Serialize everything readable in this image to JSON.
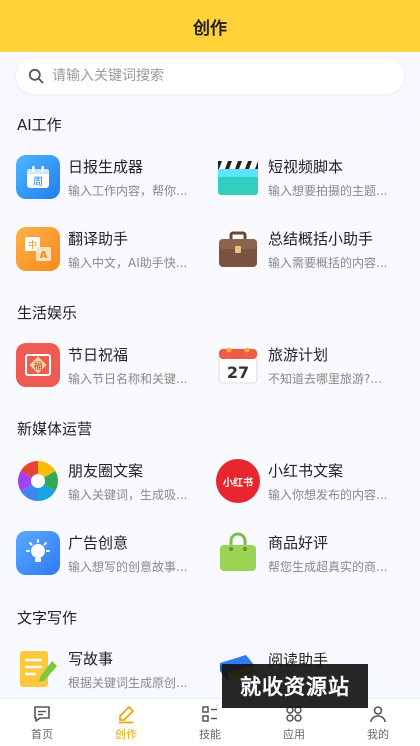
{
  "header": {
    "title": "创作"
  },
  "search": {
    "placeholder": "请输入关键词搜索"
  },
  "sections": {
    "ai_work": {
      "title": "AI工作",
      "items": [
        {
          "name": "日报生成器",
          "desc": "输入工作内容，帮你...",
          "icon": "calendar-icon"
        },
        {
          "name": "短视频脚本",
          "desc": "输入想要拍摄的主题...",
          "icon": "clapperboard-icon"
        },
        {
          "name": "翻译助手",
          "desc": "输入中文，AI助手快...",
          "icon": "translate-icon"
        },
        {
          "name": "总结概括小助手",
          "desc": "输入需要概括的内容...",
          "icon": "briefcase-icon"
        }
      ]
    },
    "life": {
      "title": "生活娱乐",
      "items": [
        {
          "name": "节日祝福",
          "desc": "输入节日名称和关键...",
          "icon": "blessing-icon"
        },
        {
          "name": "旅游计划",
          "desc": "不知道去哪里旅游?...",
          "icon": "calendar-27-icon",
          "day": "27"
        }
      ]
    },
    "new_media": {
      "title": "新媒体运营",
      "items": [
        {
          "name": "朋友圈文案",
          "desc": "输入关键词，生成吸...",
          "icon": "aperture-icon"
        },
        {
          "name": "小红书文案",
          "desc": "输入你想发布的内容...",
          "icon": "xiaohongshu-icon",
          "badge": "小红书"
        },
        {
          "name": "广告创意",
          "desc": "输入想写的创意故事...",
          "icon": "lightbulb-icon"
        },
        {
          "name": "商品好评",
          "desc": "帮您生成超真实的商...",
          "icon": "shopping-bag-icon"
        }
      ]
    },
    "writing": {
      "title": "文字写作",
      "items": [
        {
          "name": "写故事",
          "desc": "根据关键词生成原创...",
          "icon": "notepad-pencil-icon"
        },
        {
          "name": "阅读助手",
          "desc": "...",
          "icon": "books-icon"
        }
      ]
    }
  },
  "tabbar": [
    {
      "label": "首页",
      "icon": "chat-icon"
    },
    {
      "label": "创作",
      "icon": "pencil-icon",
      "active": true
    },
    {
      "label": "技能",
      "icon": "grid-icon"
    },
    {
      "label": "应用",
      "icon": "apps-icon"
    },
    {
      "label": "我的",
      "icon": "user-icon"
    }
  ],
  "watermark": "就收资源站",
  "colors": {
    "brand": "#ffd23a",
    "active_tab": "#e8a800"
  }
}
